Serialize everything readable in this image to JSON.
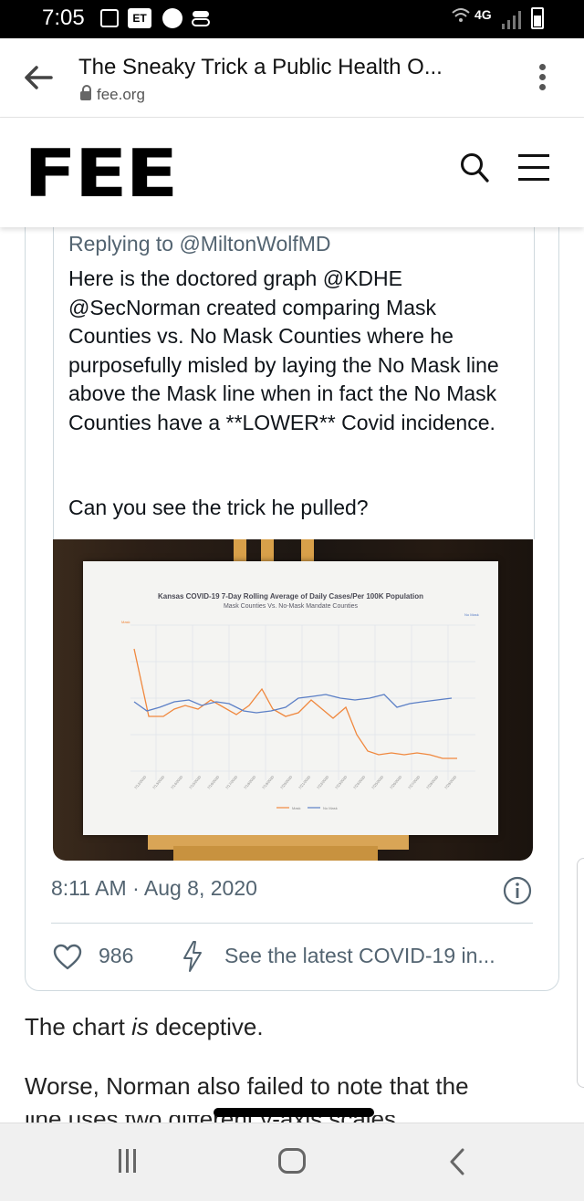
{
  "status_bar": {
    "time": "7:05",
    "et_badge": "ET",
    "network": "4G",
    "icons": [
      "calendar-icon",
      "et-icon",
      "messenger-icon",
      "toggle-icon",
      "wifi-icon",
      "signal-icon",
      "battery-icon"
    ]
  },
  "browser": {
    "page_title": "The Sneaky Trick a Public Health O...",
    "url": "fee.org"
  },
  "site": {
    "logo": "FEE"
  },
  "tweet": {
    "replying_to": "Replying to @MiltonWolfMD",
    "text": "Here is the doctored graph @KDHE @SecNorman created comparing Mask Counties vs. No Mask Counties where he purposefully misled by laying the No Mask line above the Mask line when in fact the No Mask Counties have a **LOWER** Covid incidence.",
    "question": "Can you see the trick he pulled?",
    "timestamp": "8:11 AM · Aug 8, 2020",
    "likes": "986",
    "latest_link": "See the latest COVID-19 in..."
  },
  "photo_chart": {
    "title": "Kansas COVID-19 7-Day Rolling Average of Daily Cases/Per 100K Population",
    "subtitle": "Mask Counties Vs. No-Mask Mandate Counties",
    "left_axis_label": "Mask",
    "right_axis_label": "No Mask",
    "mask_color": "#f0883e",
    "no_mask_color": "#5b7fc6"
  },
  "article": {
    "para1_before": "The chart ",
    "para1_em": "is",
    "para1_after": " deceptive.",
    "para2": "Worse, Norman also failed to note that the",
    "para3": "line uses two different y-axis scales..."
  },
  "navbar": {
    "icons": [
      "recent-apps-icon",
      "home-icon",
      "back-icon"
    ]
  }
}
